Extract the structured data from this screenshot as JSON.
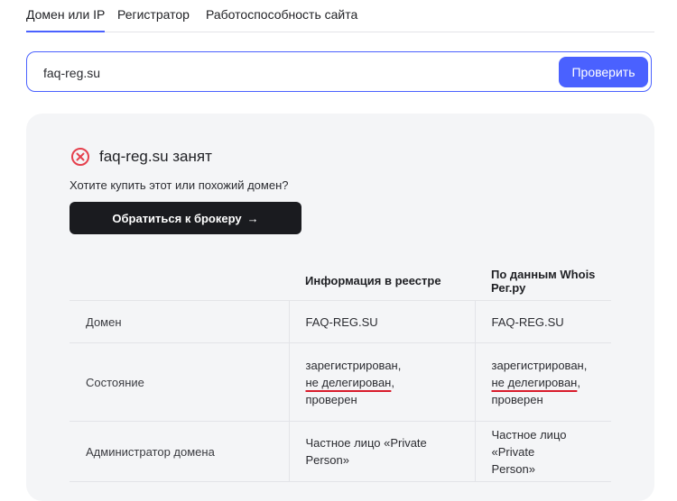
{
  "tabs": [
    {
      "label": "Домен или IP",
      "active": true
    },
    {
      "label": "Регистратор",
      "active": false
    },
    {
      "label": "Работоспособность сайта",
      "active": false
    }
  ],
  "search": {
    "value": "faq-reg.su",
    "button_label": "Проверить"
  },
  "result": {
    "title": "faq-reg.su занят",
    "question": "Хотите купить этот или похожий домен?",
    "broker_button": "Обратиться к брокеру",
    "broker_arrow": "→",
    "status_icon": "close-circle-icon",
    "status_color": "#e5404d"
  },
  "table": {
    "headers": [
      "",
      "Информация в реестре",
      "По данным Whois Рег.ру"
    ],
    "rows": {
      "domain": {
        "label": "Домен",
        "registry": "FAQ-REG.SU",
        "whois": "FAQ-REG.SU"
      },
      "state": {
        "label": "Состояние",
        "registry": {
          "line1": "зарегистрирован,",
          "line2": "не делегирован",
          "line2_suffix": ",",
          "line3": "проверен"
        },
        "whois": {
          "line1": "зарегистрирован,",
          "line2": "не делегирован",
          "line2_suffix": ",",
          "line3": "проверен"
        }
      },
      "admin": {
        "label": "Администратор домена",
        "registry": {
          "line1": "Частное лицо «Private",
          "line2": "Person»"
        },
        "whois": {
          "line1": "Частное лицо «Private",
          "line2": "Person»"
        }
      }
    }
  },
  "colors": {
    "accent": "#4a61ff",
    "dark_button": "#1a1b1f",
    "card_bg": "#f4f5f7",
    "highlight_underline": "#d81b2b"
  }
}
